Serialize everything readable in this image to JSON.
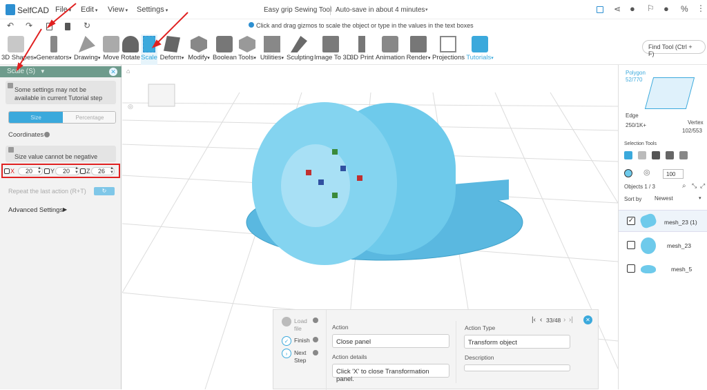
{
  "app": {
    "logo_text": "SelfCAD",
    "title": "Easy grip Sewing Tool",
    "autosave": "Auto-save in about 4 minutes"
  },
  "menus": [
    {
      "label": "File"
    },
    {
      "label": "Edit"
    },
    {
      "label": "View"
    },
    {
      "label": "Settings"
    }
  ],
  "hint": "Click and drag gizmos to scale the object or type in the values in the text boxes",
  "toolbar": [
    {
      "label": "3D Shapes"
    },
    {
      "label": "Generators"
    },
    {
      "label": "Drawing"
    },
    {
      "label": "Move"
    },
    {
      "label": "Rotate"
    },
    {
      "label": "Scale"
    },
    {
      "label": "Deform"
    },
    {
      "label": "Modify"
    },
    {
      "label": "Boolean"
    },
    {
      "label": "Tools"
    },
    {
      "label": "Utilities"
    },
    {
      "label": "Sculpting"
    },
    {
      "label": "Image To 3D"
    },
    {
      "label": "3D Print"
    },
    {
      "label": "Animation"
    },
    {
      "label": "Render"
    },
    {
      "label": "Projections"
    },
    {
      "label": "Tutorials"
    }
  ],
  "find_tool_placeholder": "Find Tool (Ctrl + F)",
  "scale_panel": {
    "title": "Scale (S)",
    "notice": "Some settings may not be available in current Tutorial step",
    "tab_size": "Size",
    "tab_percentage": "Percentage",
    "coordinates_label": "Coordinates",
    "negative_notice": "Size value cannot be negative",
    "x_label": "X",
    "x_value": "20",
    "y_label": "Y",
    "y_value": "20",
    "z_label": "Z",
    "z_value": "26",
    "repeat_label": "Repeat the last action (R+T)",
    "advanced_label": "Advanced Settings"
  },
  "right_panel": {
    "polygon_label": "Polygon",
    "polygon_count": "52/770",
    "edge_label": "Edge",
    "edge_count": "250/1K+",
    "vertex_label": "Vertex",
    "vertex_count": "102/553",
    "selection_tools": "Selection Tools",
    "spinner_value": "100",
    "objects_label": "Objects 1 / 3",
    "sort_label": "Sort by",
    "sort_value": "Newest",
    "objects": [
      {
        "name": "mesh_23 (1)",
        "checked": true
      },
      {
        "name": "mesh_23",
        "checked": false
      },
      {
        "name": "mesh_5",
        "checked": false
      }
    ]
  },
  "tutorial": {
    "step_load": "Load file",
    "step_finish": "Finish",
    "step_next": "Next Step",
    "pager": "33/48",
    "action_label": "Action",
    "action_value": "Close panel",
    "action_type_label": "Action Type",
    "action_type_value": "Transform object",
    "details_label": "Action details",
    "details_value": "Click 'X' to close Transformation panel.",
    "description_label": "Description",
    "description_value": ""
  },
  "colors": {
    "accent": "#29a3d9",
    "model": "#5ec2e6",
    "panel_header": "#6e9b8c",
    "annotation": "#e02020"
  }
}
